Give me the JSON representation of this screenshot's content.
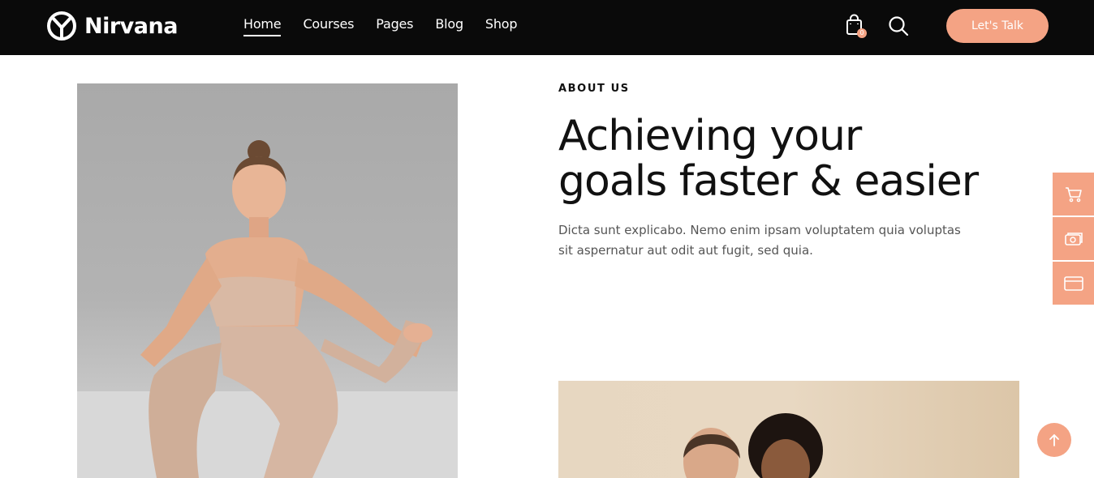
{
  "brand": {
    "name": "Nirvana",
    "logo_icon": "nirvana-logo-icon"
  },
  "nav": {
    "items": [
      {
        "label": "Home",
        "active": true
      },
      {
        "label": "Courses",
        "active": false
      },
      {
        "label": "Pages",
        "active": false
      },
      {
        "label": "Blog",
        "active": false
      },
      {
        "label": "Shop",
        "active": false
      }
    ]
  },
  "header_actions": {
    "cart_icon": "shopping-bag-icon",
    "cart_count": "0",
    "search_icon": "search-icon",
    "cta_label": "Let's Talk"
  },
  "about": {
    "eyebrow": "ABOUT US",
    "title_line1": "Achieving your",
    "title_line2": "goals faster & easier",
    "description": "Dicta sunt explicabo. Nemo enim ipsam voluptatem quia voluptas sit aspernatur aut odit aut fugit, sed quia."
  },
  "side_dock": {
    "items": [
      {
        "icon": "cart-icon"
      },
      {
        "icon": "money-icon"
      },
      {
        "icon": "browser-window-icon"
      }
    ]
  },
  "scroll_top_icon": "arrow-up-icon",
  "colors": {
    "accent": "#f4a384",
    "header_bg": "#0a0a0a",
    "text_dark": "#111111",
    "text_muted": "#555555"
  }
}
